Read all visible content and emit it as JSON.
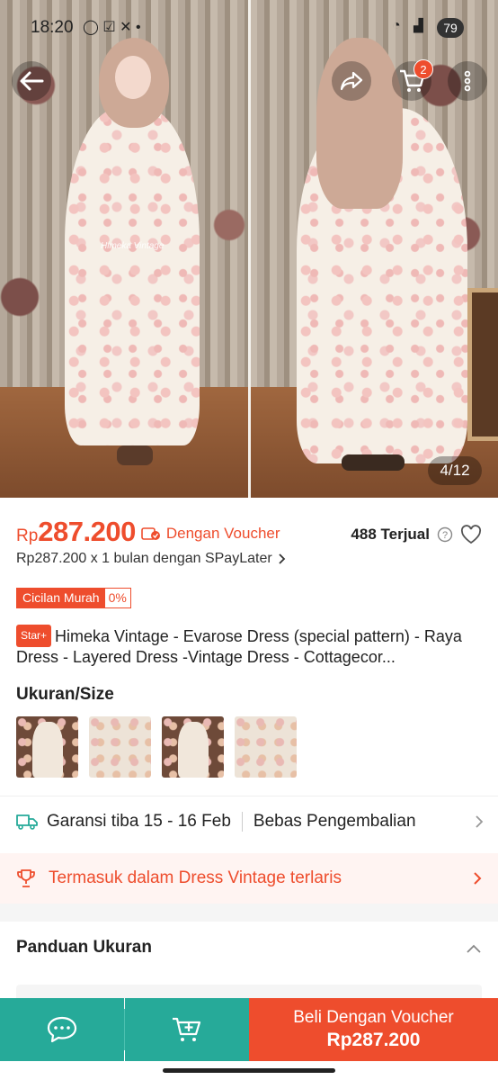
{
  "status_bar": {
    "time": "18:20",
    "battery": "79"
  },
  "gallery": {
    "counter": "4/12",
    "cart_count": "2",
    "watermark": "Himeka Vintage"
  },
  "product": {
    "currency": "Rp",
    "price": "287.200",
    "voucher_label": "Dengan Voucher",
    "sold": "488 Terjual",
    "paylater": "Rp287.200 x 1 bulan dengan SPayLater",
    "cicilan_label": "Cicilan Murah",
    "cicilan_rate": "0%",
    "badge": "Star+",
    "title": "Himeka Vintage - Evarose Dress (special pattern) - Raya Dress - Layered Dress -Vintage Dress - Cottagecor..."
  },
  "variants": {
    "label": "Ukuran/Size",
    "count": 4
  },
  "shipping": {
    "guarantee": "Garansi tiba 15 - 16 Feb",
    "returns": "Bebas Pengembalian"
  },
  "bestseller": {
    "text": "Termasuk dalam Dress Vintage terlaris"
  },
  "size_guide": {
    "title": "Panduan Ukuran"
  },
  "bottom_bar": {
    "buy_label": "Beli Dengan Voucher",
    "buy_price": "Rp287.200"
  },
  "colors": {
    "accent": "#ee4d2d",
    "teal": "#26aa99"
  },
  "icons": [
    "back-arrow-icon",
    "share-icon",
    "cart-icon",
    "more-icon",
    "voucher-icon",
    "help-icon",
    "heart-icon",
    "chevron-right-icon",
    "truck-icon",
    "trophy-icon",
    "chevron-up-icon",
    "chat-icon",
    "add-to-cart-icon"
  ]
}
